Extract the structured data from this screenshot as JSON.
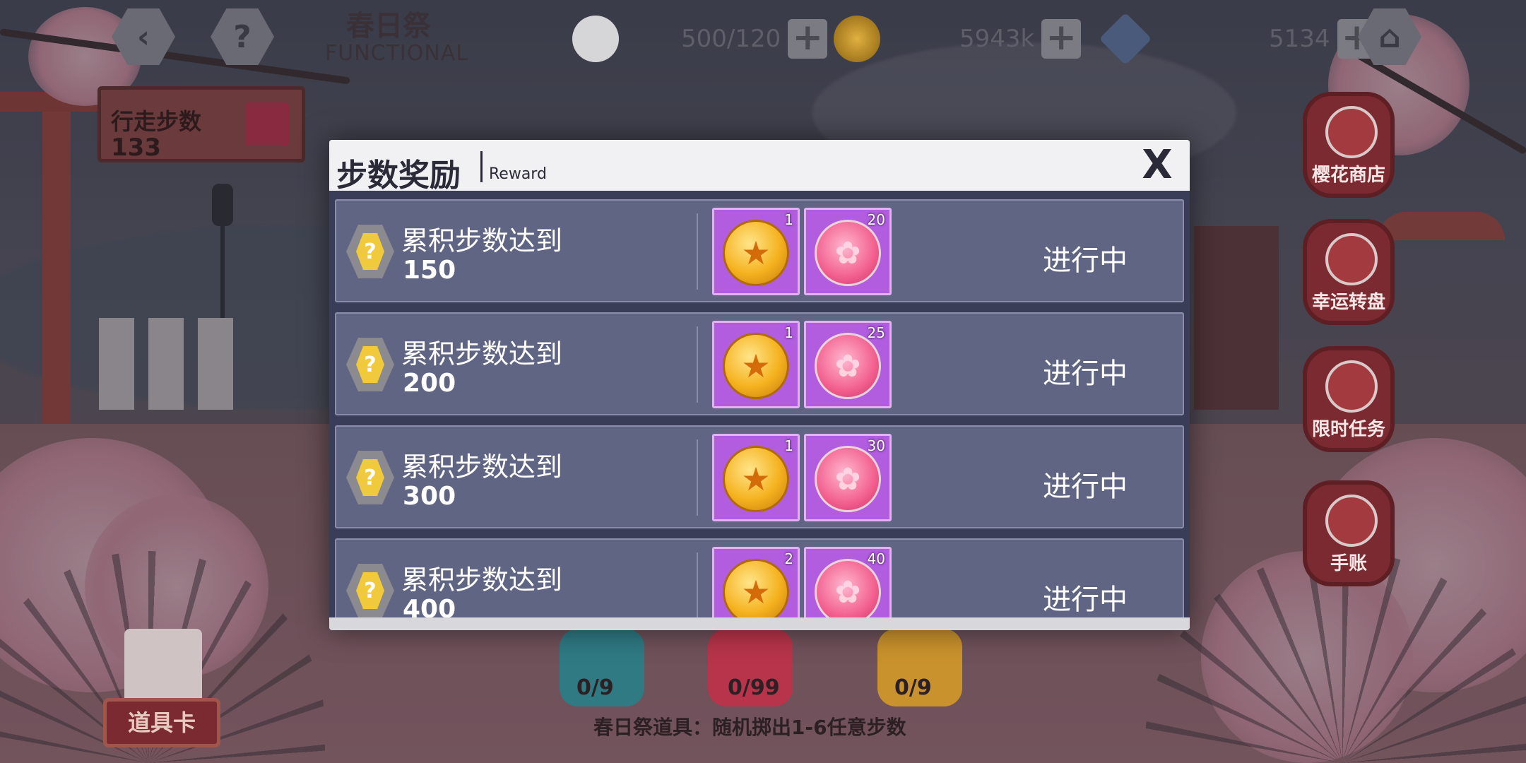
{
  "hud": {
    "back_icon": "back-arrow-icon",
    "help_label": "?",
    "event_title": "春日祭",
    "event_subtitle": "FUNCTIONAL",
    "stamina": "500/120",
    "coins": "5943k",
    "gems": "5134",
    "home_icon": "home-icon"
  },
  "steps": {
    "label": "行走步数",
    "value": "133"
  },
  "side_menu": [
    {
      "label": "樱花商店"
    },
    {
      "label": "幸运转盘"
    },
    {
      "label": "限时任务"
    },
    {
      "label": "手账"
    }
  ],
  "modal": {
    "title": "步数奖励",
    "subtitle": "Reward",
    "close_label": "X",
    "rows": [
      {
        "label": "累积步数达到",
        "target": "150",
        "coin_count": "1",
        "sakura_count": "20",
        "status": "进行中"
      },
      {
        "label": "累积步数达到",
        "target": "200",
        "coin_count": "1",
        "sakura_count": "25",
        "status": "进行中"
      },
      {
        "label": "累积步数达到",
        "target": "300",
        "coin_count": "1",
        "sakura_count": "30",
        "status": "进行中"
      },
      {
        "label": "累积步数达到",
        "target": "400",
        "coin_count": "2",
        "sakura_count": "40",
        "status": "进行中"
      }
    ]
  },
  "bottom": {
    "dice": [
      {
        "count": "0/9",
        "color": "#2f7a83"
      },
      {
        "count": "0/99",
        "color": "#b8344a"
      },
      {
        "count": "0/9",
        "color": "#c9922c"
      }
    ],
    "item_card_label": "道具卡",
    "description": "春日祭道具：随机掷出1-6任意步数"
  },
  "colors": {
    "modal_list_bg": "#3a3d58",
    "row_bg": "#616584",
    "reward_bg": "#b25ce0"
  }
}
